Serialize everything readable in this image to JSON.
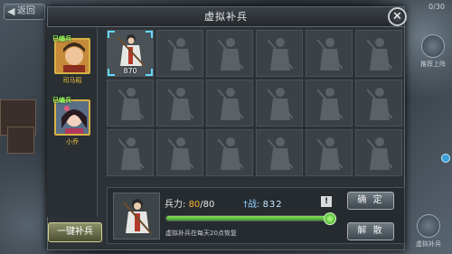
{
  "world": {
    "back_label": "返回",
    "counter": "0/30",
    "side_button_label": "推荐上阵",
    "bottom_right_label": "虚拟补兵"
  },
  "dialog": {
    "title": "虚拟补兵",
    "close_glyph": "✕"
  },
  "heroes": [
    {
      "tag": "已编兵",
      "name": "司马昭"
    },
    {
      "tag": "已编兵",
      "name": "小乔"
    }
  ],
  "grid": {
    "selected_count": "870",
    "rows": 3,
    "cols": 6
  },
  "panel": {
    "troops_label": "兵力:",
    "troops_current": "80",
    "troops_max": "/80",
    "power_icon": "†",
    "power_label": "战:",
    "power_value": "832",
    "info_glyph": "!",
    "hint": "虚拟补兵在每天20点恢复",
    "fill_fraction": 1.0
  },
  "buttons": {
    "confirm": "确 定",
    "dismiss": "解 散",
    "auto_fill": "一键补兵"
  },
  "colors": {
    "accent_green": "#9bff62",
    "name_gold": "#f2c33b",
    "troops_orange": "#ffb534",
    "power_blue": "#8fd0ff",
    "select_cyan": "#62d8ff"
  }
}
